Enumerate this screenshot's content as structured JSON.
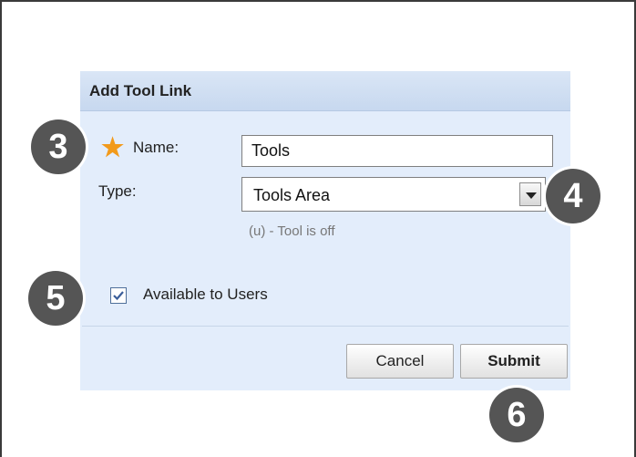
{
  "dialog": {
    "title": "Add Tool Link",
    "name_label": "Name:",
    "name_value": "Tools",
    "type_label": "Type:",
    "type_value": "Tools Area",
    "hint": "(u) - Tool is off",
    "available_label": "Available to Users",
    "available_checked": true,
    "cancel_label": "Cancel",
    "submit_label": "Submit"
  },
  "callouts": {
    "three": "3",
    "four": "4",
    "five": "5",
    "six": "6"
  },
  "colors": {
    "accent_star": "#f29a1b",
    "panel_bg": "#e3edfb",
    "badge_bg": "#555555"
  }
}
